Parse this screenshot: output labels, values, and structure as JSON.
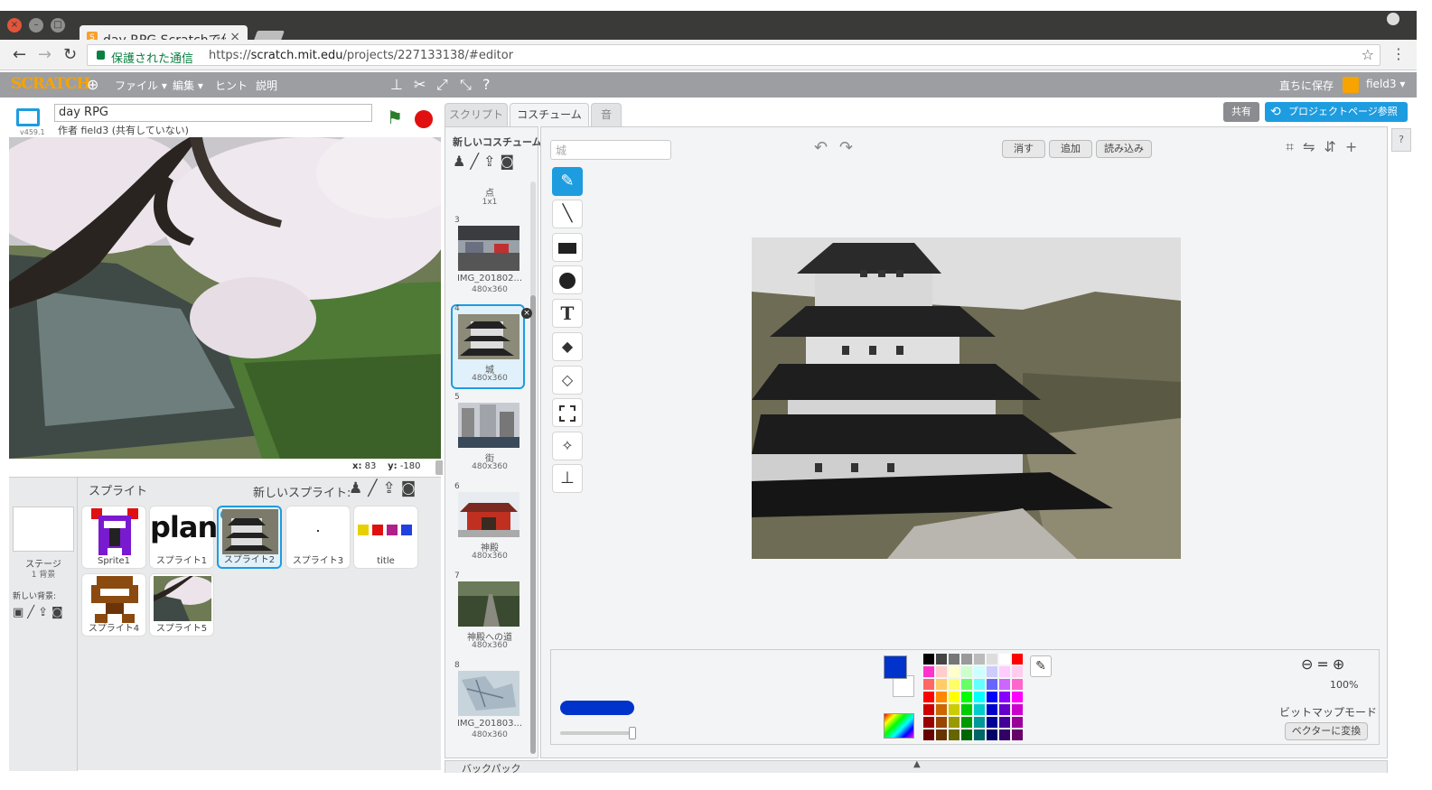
{
  "browser": {
    "tab_title": "day RPG Scratchで作",
    "secure_label": "保護された通信",
    "url_scheme": "https://",
    "url_host": "scratch.mit.edu",
    "url_path": "/projects/227133138/#editor"
  },
  "menubar": {
    "logo": "SCRATCH",
    "file": "ファイル ▾",
    "edit": "編集 ▾",
    "tips": "ヒント",
    "about": "説明",
    "save_now": "直ちに保存",
    "user": "field3 ▾"
  },
  "stage": {
    "version": "v459.1",
    "project_title": "day RPG",
    "author": "作者 field3 (共有していない)",
    "x_label": "x:",
    "x_value": "83",
    "y_label": "y:",
    "y_value": "-180"
  },
  "tabs": {
    "scripts": "スクリプト",
    "costumes": "コスチューム",
    "sounds": "音"
  },
  "header_buttons": {
    "share": "共有",
    "see_project_page": "プロジェクトページ参照"
  },
  "sprite_pane": {
    "title": "スプライト",
    "new_sprite": "新しいスプライト:",
    "stage_label": "ステージ",
    "stage_count": "1 背景",
    "new_backdrop": "新しい背景:",
    "sprites": [
      {
        "name": "Sprite1"
      },
      {
        "name": "スプライト1",
        "text": "plan"
      },
      {
        "name": "スプライト2"
      },
      {
        "name": "スプライト3"
      },
      {
        "name": "title"
      },
      {
        "name": "スプライト4"
      },
      {
        "name": "スプライト5"
      }
    ]
  },
  "costumes": {
    "new_costume": "新しいコスチューム:",
    "items": [
      {
        "num": "",
        "name": "点",
        "dim": "1x1"
      },
      {
        "num": "3",
        "name": "IMG_201802...",
        "dim": "480x360"
      },
      {
        "num": "4",
        "name": "城",
        "dim": "480x360"
      },
      {
        "num": "5",
        "name": "街",
        "dim": "480x360"
      },
      {
        "num": "6",
        "name": "神殿",
        "dim": "480x360"
      },
      {
        "num": "7",
        "name": "神殿への道",
        "dim": "480x360"
      },
      {
        "num": "8",
        "name": "IMG_201803...",
        "dim": "480x360"
      }
    ]
  },
  "editor": {
    "costume_name": "城",
    "clear": "消す",
    "add": "追加",
    "import": "読み込み",
    "zoom": "100%",
    "mode": "ビットマップモード",
    "convert": "ベクターに変換"
  },
  "backpack": "バックパック",
  "colors": {
    "accent": "#1d9ce0",
    "primary_color": "#0033cc"
  }
}
